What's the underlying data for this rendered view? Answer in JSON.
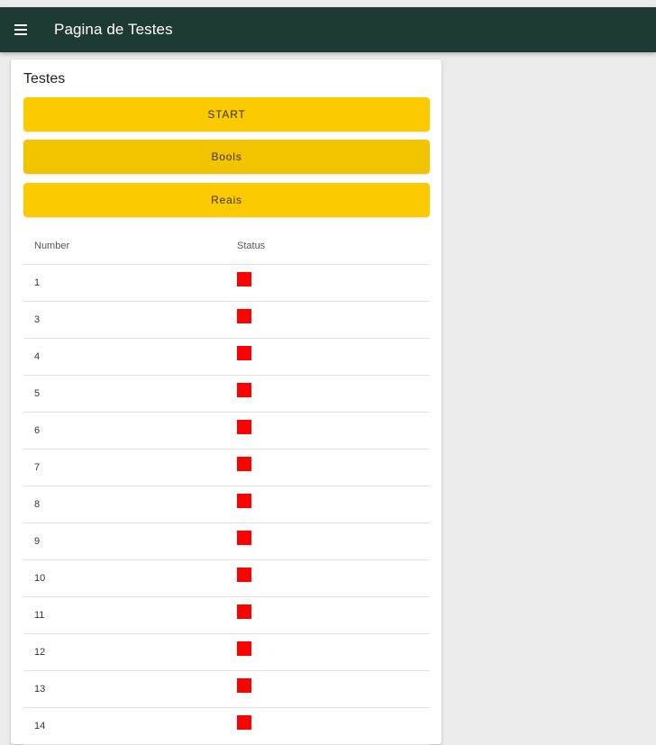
{
  "appbar": {
    "menu_icon": "menu-icon",
    "title": "Pagina de Testes",
    "background": "#1e3a34"
  },
  "card": {
    "title": "Testes",
    "buttons": {
      "start": "START",
      "bools": "Bools",
      "reais": "Reais"
    },
    "button_color": "#fcca00"
  },
  "table": {
    "headers": {
      "number": "Number",
      "status": "Status"
    },
    "status_color": "#ff0000",
    "rows": [
      {
        "number": "1",
        "status": "red"
      },
      {
        "number": "3",
        "status": "red"
      },
      {
        "number": "4",
        "status": "red"
      },
      {
        "number": "5",
        "status": "red"
      },
      {
        "number": "6",
        "status": "red"
      },
      {
        "number": "7",
        "status": "red"
      },
      {
        "number": "8",
        "status": "red"
      },
      {
        "number": "9",
        "status": "red"
      },
      {
        "number": "10",
        "status": "red"
      },
      {
        "number": "11",
        "status": "red"
      },
      {
        "number": "12",
        "status": "red"
      },
      {
        "number": "13",
        "status": "red"
      },
      {
        "number": "14",
        "status": "red"
      }
    ]
  }
}
